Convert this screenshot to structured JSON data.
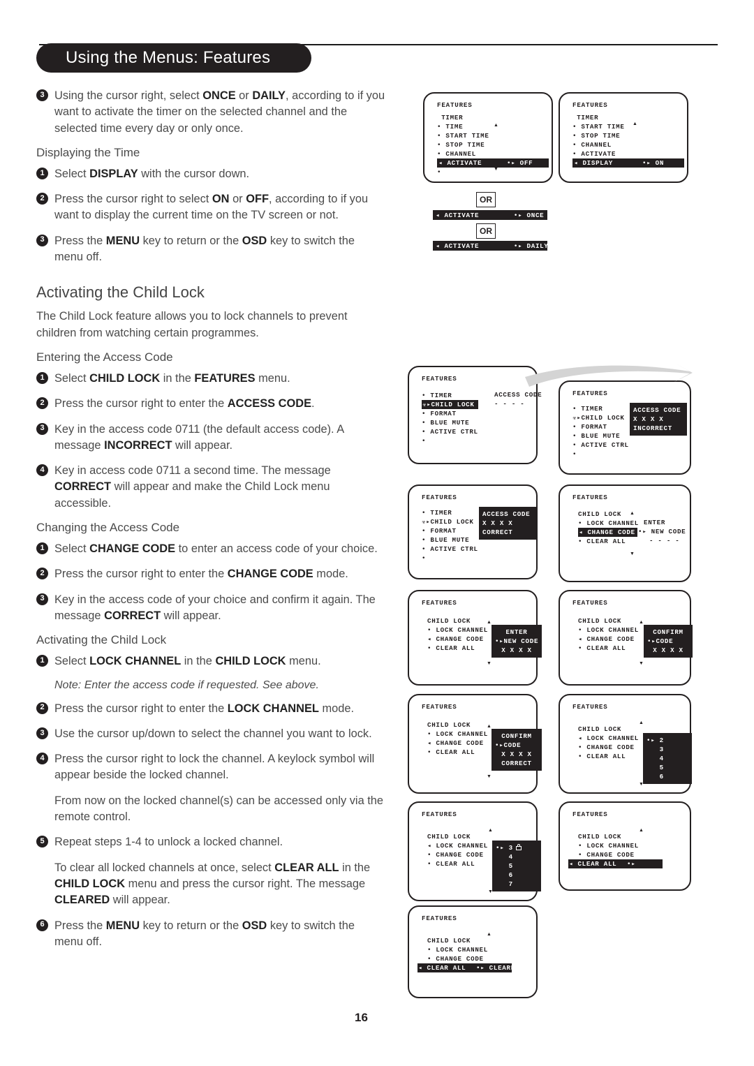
{
  "header": {
    "title": "Using the Menus: Features"
  },
  "page_number": "16",
  "left": {
    "blocks": [
      {
        "type": "step",
        "num": "3",
        "html": "Using the cursor right, select <b>ONCE</b> or <b>DAILY</b>, according to if you want to activate the timer on the selected channel and the selected time every day or only once."
      },
      {
        "type": "subhead",
        "html": "Displaying the Time"
      },
      {
        "type": "step",
        "num": "1",
        "html": "Select <b>DISPLAY</b> with the cursor down."
      },
      {
        "type": "step",
        "num": "2",
        "html": "Press the cursor right to select <b>ON</b> or <b>OFF</b>, according to if you want to display the current time on the TV screen or not."
      },
      {
        "type": "step",
        "num": "3",
        "html": "Press the <b>MENU</b> key to return or the <b>OSD</b> key to switch the menu off."
      },
      {
        "type": "sechead",
        "html": "Activating the Child Lock"
      },
      {
        "type": "para",
        "html": "The Child Lock feature allows you to lock channels to prevent children from watching certain programmes."
      },
      {
        "type": "subhead",
        "html": "Entering the Access Code"
      },
      {
        "type": "step",
        "num": "1",
        "html": "Select <b>CHILD LOCK</b> in the <b>FEATURES</b> menu."
      },
      {
        "type": "step",
        "num": "2",
        "html": "Press the cursor right to enter the <b>ACCESS CODE</b>."
      },
      {
        "type": "step",
        "num": "3",
        "html": "Key in the access code 0711 (the default access code). A message <b>INCORRECT</b> will appear."
      },
      {
        "type": "step",
        "num": "4",
        "html": "Key in access code 0711 a second time. The message <b>CORRECT</b> will appear and make the Child Lock menu accessible."
      },
      {
        "type": "subhead",
        "html": "Changing the Access Code"
      },
      {
        "type": "step",
        "num": "1",
        "html": "Select <b>CHANGE CODE</b> to enter an access code of your choice."
      },
      {
        "type": "step",
        "num": "2",
        "html": "Press the cursor right to enter the <b>CHANGE CODE</b> mode."
      },
      {
        "type": "step",
        "num": "3",
        "html": "Key in the access code of your choice and confirm it again. The message <b>CORRECT</b> will appear."
      },
      {
        "type": "subhead",
        "html": "Activating the Child Lock"
      },
      {
        "type": "step",
        "num": "1",
        "html": "Select <b>LOCK CHANNEL</b> in the <b>CHILD LOCK</b> menu."
      },
      {
        "type": "note",
        "html": "Note: Enter the access code if requested. See above."
      },
      {
        "type": "step",
        "num": "2",
        "html": "Press the cursor right to enter the <b>LOCK CHANNEL</b> mode."
      },
      {
        "type": "step",
        "num": "3",
        "html": "Use the cursor up/down to select the channel you want to lock."
      },
      {
        "type": "step",
        "num": "4",
        "html": "Press the cursor right to lock the channel. A keylock symbol will appear beside the locked channel."
      },
      {
        "type": "para-indent",
        "html": "From now on the locked channel(s) can be accessed only via the remote control."
      },
      {
        "type": "step",
        "num": "5",
        "html": "Repeat steps 1-4 to unlock a locked channel."
      },
      {
        "type": "para-indent",
        "html": "To clear all locked channels at once, select <b>CLEAR ALL</b> in the <b>CHILD LOCK</b> menu and press the cursor right. The message <b>CLEARED</b> will appear."
      },
      {
        "type": "step",
        "num": "6",
        "html": "Press the <b>MENU</b> key to return or the <b>OSD</b> key to switch the menu off."
      }
    ]
  },
  "osd": {
    "menu_title": "FEATURES",
    "or_label": "OR",
    "screen1": {
      "heading": "TIMER",
      "items": [
        "TIME",
        "START TIME",
        "STOP TIME",
        "CHANNEL"
      ],
      "selected_label": "ACTIVATE",
      "selected_value": "OFF"
    },
    "screen2": {
      "heading": "TIMER",
      "items": [
        "START TIME",
        "STOP TIME",
        "CHANNEL",
        "ACTIVATE"
      ],
      "selected_label": "DISPLAY",
      "selected_value": "ON"
    },
    "strip_once": {
      "label": "ACTIVATE",
      "value": "ONCE"
    },
    "strip_daily": {
      "label": "ACTIVATE",
      "value": "DAILY"
    },
    "screen3": {
      "items": [
        "TIMER",
        "CHILD LOCK",
        "FORMAT",
        "BLUE MUTE",
        "ACTIVE CTRL"
      ],
      "selected": "CHILD LOCK",
      "panel_title": "ACCESS CODE",
      "panel_value": "- - - -"
    },
    "screen4": {
      "items": [
        "TIMER",
        "CHILD LOCK",
        "FORMAT",
        "BLUE MUTE",
        "ACTIVE CTRL"
      ],
      "marked": "CHILD LOCK",
      "panel_lines": [
        "ACCESS CODE",
        "X X X X",
        "INCORRECT"
      ]
    },
    "screen5": {
      "items": [
        "TIMER",
        "CHILD LOCK",
        "FORMAT",
        "BLUE MUTE",
        "ACTIVE CTRL"
      ],
      "marked": "CHILD LOCK",
      "panel_lines": [
        "ACCESS CODE",
        "X X X X",
        "CORRECT"
      ]
    },
    "screen6": {
      "heading": "CHILD LOCK",
      "items": [
        "LOCK CHANNEL",
        "CHANGE CODE",
        "CLEAR ALL"
      ],
      "selected": "CHANGE CODE",
      "values": [
        "ENTER",
        "NEW CODE",
        "- - - -"
      ]
    },
    "screen7": {
      "heading": "CHILD LOCK",
      "items": [
        "LOCK CHANNEL",
        "CHANGE CODE",
        "CLEAR ALL"
      ],
      "marked": "CHANGE CODE",
      "panel_lines": [
        "ENTER",
        "NEW CODE",
        "X X X X"
      ]
    },
    "screen8": {
      "heading": "CHILD LOCK",
      "items": [
        "LOCK CHANNEL",
        "CHANGE CODE",
        "CLEAR ALL"
      ],
      "marked": "CHANGE CODE",
      "panel_lines": [
        "CONFIRM",
        "CODE",
        "X X X X"
      ]
    },
    "screen9": {
      "heading": "CHILD LOCK",
      "items": [
        "LOCK CHANNEL",
        "CHANGE CODE",
        "CLEAR ALL"
      ],
      "marked": "CHANGE CODE",
      "panel_lines": [
        "CONFIRM",
        "CODE",
        "X X X X",
        "CORRECT"
      ]
    },
    "screen10": {
      "heading": "CHILD LOCK",
      "items": [
        "LOCK CHANNEL",
        "CHANGE CODE",
        "CLEAR ALL"
      ],
      "marked": "LOCK CHANNEL",
      "channels": [
        "2",
        "3",
        "4",
        "5",
        "6"
      ]
    },
    "screen11": {
      "heading": "CHILD LOCK",
      "items": [
        "LOCK CHANNEL",
        "CHANGE CODE",
        "CLEAR ALL"
      ],
      "marked": "LOCK CHANNEL",
      "channels": [
        "3",
        "4",
        "5",
        "6",
        "7"
      ],
      "locked_channel": "3"
    },
    "screen12": {
      "heading": "CHILD LOCK",
      "items": [
        "LOCK CHANNEL",
        "CHANGE CODE"
      ],
      "selected_label": "CLEAR ALL",
      "selected_value": ""
    },
    "screen13": {
      "heading": "CHILD LOCK",
      "items": [
        "LOCK CHANNEL",
        "CHANGE CODE"
      ],
      "selected_label": "CLEAR ALL",
      "selected_value": "CLEARED"
    }
  }
}
